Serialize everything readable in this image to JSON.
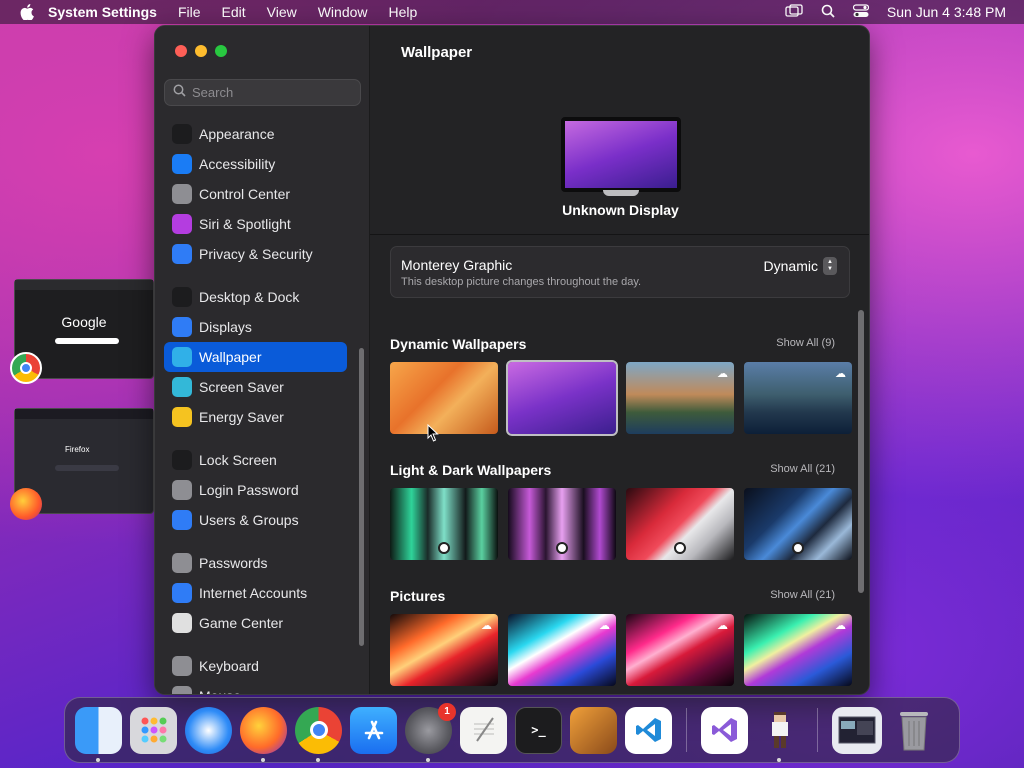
{
  "menubar": {
    "app_name": "System Settings",
    "menus": [
      "File",
      "Edit",
      "View",
      "Window",
      "Help"
    ],
    "clock": "Sun Jun 4  3:48 PM"
  },
  "sidebar": {
    "search_placeholder": "Search",
    "groups": [
      [
        {
          "label": "Appearance",
          "icon": "appearance-icon",
          "color": "#1c1c1e"
        },
        {
          "label": "Accessibility",
          "icon": "accessibility-icon",
          "color": "#1a7cf5"
        },
        {
          "label": "Control Center",
          "icon": "control-center-icon",
          "color": "#8e8e93"
        },
        {
          "label": "Siri & Spotlight",
          "icon": "siri-icon",
          "color": "#b43de0"
        },
        {
          "label": "Privacy & Security",
          "icon": "privacy-hand-icon",
          "color": "#2f7cf6"
        }
      ],
      [
        {
          "label": "Desktop & Dock",
          "icon": "desktop-dock-icon",
          "color": "#1c1c1e"
        },
        {
          "label": "Displays",
          "icon": "displays-icon",
          "color": "#2f7cf6"
        },
        {
          "label": "Wallpaper",
          "icon": "wallpaper-icon",
          "color": "#30b0e8",
          "selected": true
        },
        {
          "label": "Screen Saver",
          "icon": "screen-saver-icon",
          "color": "#33b8d8"
        },
        {
          "label": "Energy Saver",
          "icon": "energy-saver-icon",
          "color": "#f5c320"
        }
      ],
      [
        {
          "label": "Lock Screen",
          "icon": "lock-screen-icon",
          "color": "#1c1c1e"
        },
        {
          "label": "Login Password",
          "icon": "login-password-icon",
          "color": "#8e8e93"
        },
        {
          "label": "Users & Groups",
          "icon": "users-groups-icon",
          "color": "#2f7cf6"
        }
      ],
      [
        {
          "label": "Passwords",
          "icon": "passwords-key-icon",
          "color": "#8e8e93"
        },
        {
          "label": "Internet Accounts",
          "icon": "internet-accounts-icon",
          "color": "#2f7cf6"
        },
        {
          "label": "Game Center",
          "icon": "game-center-icon",
          "color": "#e0e0e0"
        }
      ],
      [
        {
          "label": "Keyboard",
          "icon": "keyboard-icon",
          "color": "#8e8e93"
        },
        {
          "label": "Mouse",
          "icon": "mouse-icon",
          "color": "#8e8e93"
        }
      ]
    ]
  },
  "content": {
    "title": "Wallpaper",
    "display_name": "Unknown Display",
    "current": {
      "name": "Monterey Graphic",
      "description": "This desktop picture changes throughout the day.",
      "mode": "Dynamic"
    },
    "sections": [
      {
        "title": "Dynamic Wallpapers",
        "show_all": "Show All (9)"
      },
      {
        "title": "Light & Dark Wallpapers",
        "show_all": "Show All (21)"
      },
      {
        "title": "Pictures",
        "show_all": "Show All (21)"
      }
    ]
  },
  "dock": {
    "apps": [
      "Finder",
      "Launchpad",
      "Safari",
      "Firefox",
      "Chrome",
      "App Store",
      "System Settings",
      "TextEdit",
      "Terminal",
      "GarageBand",
      "VS Code",
      "Visual Studio",
      "Character",
      "Screenshot",
      "Trash"
    ],
    "settings_badge": "1"
  },
  "desktop": {
    "chrome_window_text": "Google",
    "firefox_window_text": "Firefox"
  }
}
